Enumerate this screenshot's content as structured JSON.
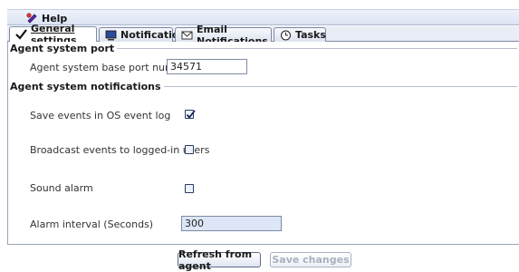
{
  "helpbar": {
    "help_label": "Help"
  },
  "tabs": [
    {
      "label": "General settings",
      "icon": "checkmark-icon",
      "active": true
    },
    {
      "label": "Notifications",
      "icon": "monitor-icon",
      "active": false
    },
    {
      "label": "Email Notifications",
      "icon": "envelope-icon",
      "active": false
    },
    {
      "label": "Tasks",
      "icon": "clock-icon",
      "active": false
    }
  ],
  "port_group": {
    "title": "Agent system port",
    "base_port_label": "Agent system base port number",
    "base_port_value": "34571"
  },
  "notif_group": {
    "title": "Agent system notifications",
    "save_events_label": "Save events in OS event log",
    "save_events_checked": true,
    "broadcast_label": "Broadcast events to logged-in users",
    "broadcast_checked": false,
    "sound_alarm_label": "Sound alarm",
    "sound_alarm_checked": false,
    "alarm_interval_label": "Alarm interval (Seconds)",
    "alarm_interval_value": "300"
  },
  "buttons": {
    "refresh_label": "Refresh from agent",
    "save_label": "Save changes"
  },
  "colors": {
    "accent": "#2b3b66",
    "tab_bg": "#dde3ef",
    "field_tint": "#dde6f7"
  }
}
